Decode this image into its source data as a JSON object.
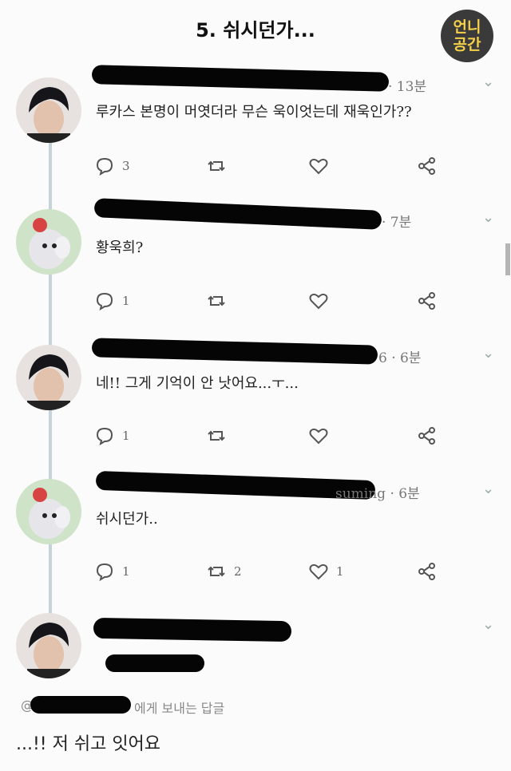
{
  "page": {
    "title": "5. 쉬시던가..."
  },
  "badge": {
    "line1": "언니",
    "line2": "공간"
  },
  "tweets": [
    {
      "time": "· 13분",
      "text": "루카스 본명이 머엿더라 무슨 욱이엇는데 재욱인가??",
      "reply_count": "3",
      "retweet_count": "",
      "like_count": ""
    },
    {
      "time": "· 7분",
      "text": "황욱희?",
      "reply_count": "1",
      "retweet_count": "",
      "like_count": ""
    },
    {
      "time": "6 · 6분",
      "text": "네!! 그게 기억이 안 낫어요...ㅜ...",
      "reply_count": "1",
      "retweet_count": "",
      "like_count": ""
    },
    {
      "time": "suming · 6분",
      "text": "쉬시던가..",
      "reply_count": "1",
      "retweet_count": "2",
      "like_count": "1"
    }
  ],
  "focused": {
    "reply_prefix": "@",
    "reply_suffix": "에게 보내는 답글",
    "text": "...!! 저 쉬고 잇어요"
  },
  "icons": [
    "reply-icon",
    "retweet-icon",
    "like-icon",
    "share-icon",
    "chevron-down-icon"
  ],
  "colors": {
    "redaction": "#050505",
    "thread_line": "#c6d3dc",
    "badge_bg": "#3a3a3a",
    "badge_text": "#f5d04a"
  }
}
